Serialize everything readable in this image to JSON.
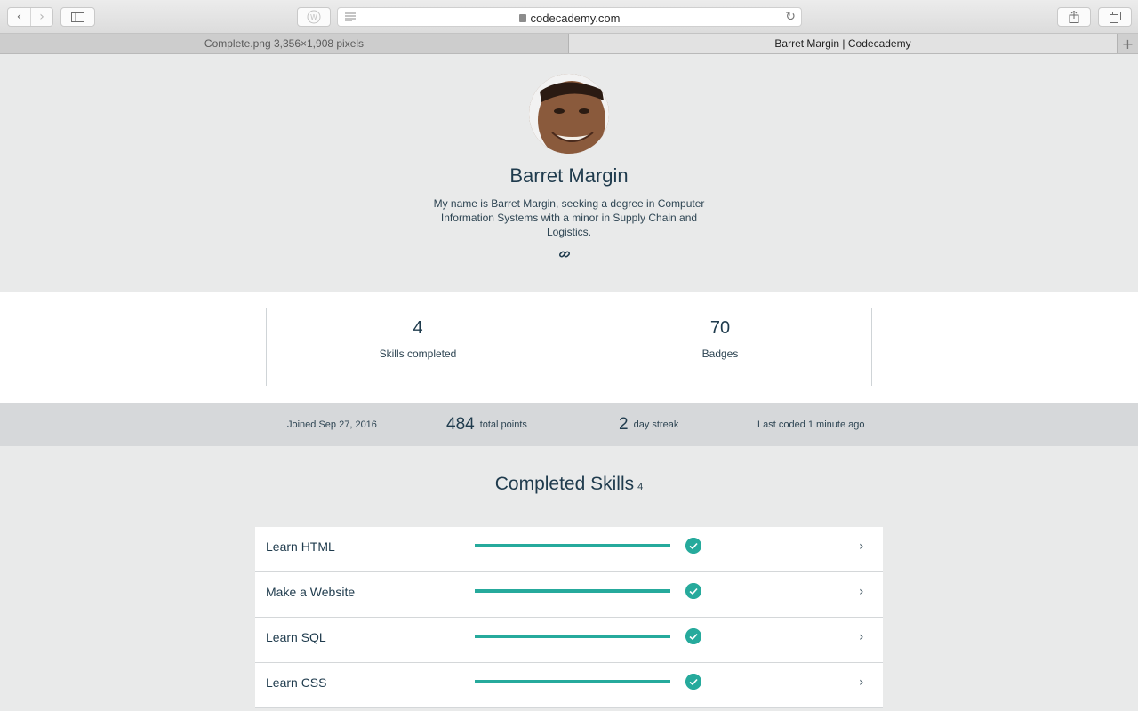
{
  "browser": {
    "url": "codecademy.com",
    "tabs": [
      {
        "label": "Complete.png 3,356×1,908 pixels"
      },
      {
        "label": "Barret Margin | Codecademy"
      }
    ],
    "icons": {
      "back": "chevron-left-icon",
      "forward": "chevron-right-icon",
      "sidebar": "sidebar-icon",
      "reader": "reader-icon",
      "reload": "reload-icon",
      "share": "share-icon",
      "tabs": "tabs-icon",
      "add_tab": "plus-icon"
    }
  },
  "profile": {
    "name": "Barret Margin",
    "bio": "My name is Barret Margin, seeking a degree in Computer Information Systems with a minor in Supply Chain and Logistics."
  },
  "stats": [
    {
      "value": "4",
      "label": "Skills completed"
    },
    {
      "value": "70",
      "label": "Badges"
    }
  ],
  "metrics": {
    "joined": "Joined Sep 27, 2016",
    "points_value": "484",
    "points_label": "total points",
    "streak_value": "2",
    "streak_label": "day streak",
    "last_coded": "Last coded 1 minute ago"
  },
  "skills": {
    "title": "Completed Skills",
    "count": "4",
    "items": [
      {
        "name": "Learn HTML",
        "progress": 1.0
      },
      {
        "name": "Make a Website",
        "progress": 1.0
      },
      {
        "name": "Learn SQL",
        "progress": 1.0
      },
      {
        "name": "Learn CSS",
        "progress": 1.0
      }
    ]
  },
  "colors": {
    "accent": "#26aa9c",
    "text": "#1f3b4d",
    "page_bg": "#e9eaea"
  }
}
